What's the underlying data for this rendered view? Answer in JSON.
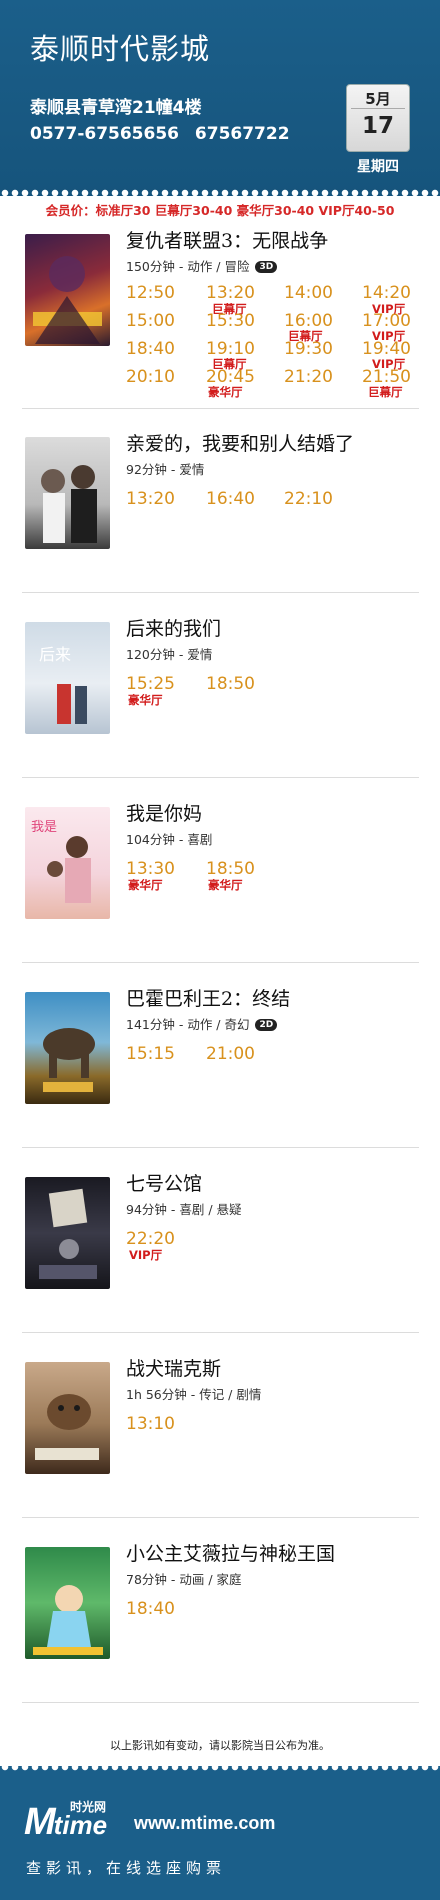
{
  "header": {
    "cinema_name": "泰顺时代影城",
    "address": "泰顺县青草湾21幢4楼",
    "phone": "0577-67565656  67567722",
    "month": "5月",
    "day": "17",
    "weekday": "星期四"
  },
  "member_price": "会员价：标准厅30  巨幕厅30-40  豪华厅30-40  VIP厅40-50",
  "movies": [
    {
      "title": "复仇者联盟3：无限战争",
      "info": "150分钟 - 动作 / 冒险",
      "tag": "3D",
      "times": [
        "12:50",
        "13:20",
        "14:00",
        "14:20",
        "15:00",
        "15:30",
        "16:00",
        "17:00",
        "18:40",
        "19:10",
        "19:30",
        "19:40",
        "20:10",
        "20:45",
        "21:20",
        "21:50"
      ],
      "halls": [
        "巨幕厅",
        "VIP厅",
        "巨幕厅",
        "VIP厅",
        "巨幕厅",
        "VIP厅",
        "豪华厅",
        "巨幕厅"
      ]
    },
    {
      "title": "亲爱的，我要和别人结婚了",
      "info": "92分钟 - 爱情",
      "times": [
        "13:20",
        "16:40",
        "22:10"
      ]
    },
    {
      "title": "后来的我们",
      "info": "120分钟 - 爱情",
      "times": [
        "15:25",
        "18:50"
      ],
      "halls": [
        "豪华厅"
      ]
    },
    {
      "title": "我是你妈",
      "info": "104分钟 - 喜剧",
      "times": [
        "13:30",
        "18:50"
      ],
      "halls": [
        "豪华厅",
        "豪华厅"
      ]
    },
    {
      "title": "巴霍巴利王2：终结",
      "info": "141分钟 - 动作 / 奇幻",
      "tag": "2D",
      "times": [
        "15:15",
        "21:00"
      ]
    },
    {
      "title": "七号公馆",
      "info": "94分钟 - 喜剧 / 悬疑",
      "times": [
        "22:20"
      ],
      "halls": [
        "VIP厅"
      ]
    },
    {
      "title": "战犬瑞克斯",
      "info": "1h 56分钟 - 传记 / 剧情",
      "times": [
        "13:10"
      ]
    },
    {
      "title": "小公主艾薇拉与神秘王国",
      "info": "78分钟 - 动画 / 家庭",
      "times": [
        "18:40"
      ]
    }
  ],
  "footer": {
    "note": "以上影讯如有变动，请以影院当日公布为准。",
    "logo_m": "M",
    "logo_text": "time",
    "logo_cn": "时光网",
    "url": "www.mtime.com",
    "slogan": "查影讯，在线选座购票"
  },
  "colors": {
    "header_blue": "#1b5f8a",
    "time_orange": "#d8911d",
    "hall_red": "#d21c1c"
  }
}
